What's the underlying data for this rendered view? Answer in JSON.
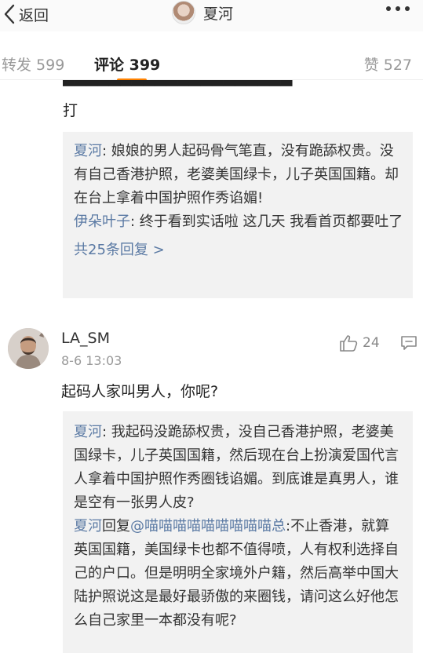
{
  "header": {
    "back_label": "返回",
    "title": "夏河"
  },
  "tabs": {
    "repost": "转发 599",
    "comments": "评论 399",
    "likes": "赞 527"
  },
  "prev_comment": {
    "text_tail": "打"
  },
  "prev_replies": {
    "items": [
      {
        "author": "夏河",
        "text": ": 娘娘的男人起码骨气笔直，没有跪舔权贵。没有自己香港护照，老婆美国绿卡，儿子英国国籍。却在台上拿着中国护照作秀谄媚!"
      },
      {
        "author": "伊朵叶子",
        "text": ": 终于看到实话啦 这几天 我看首页都要吐了"
      }
    ],
    "more": "共25条回复 >"
  },
  "comment": {
    "username": "LA_SM",
    "timestamp": "8-6 13:03",
    "like_count": "24",
    "text": "起码人家叫男人，你呢?"
  },
  "replies": {
    "r1_author": "夏河",
    "r1_text": ": 我起码没跪舔权贵，没自己香港护照，老婆美国绿卡，儿子英国国籍，然后现在台上扮演爱国代言人拿着中国护照作秀圈钱谄媚。到底谁是真男人，谁是空有一张男人皮?",
    "r2_author": "夏河",
    "r2_reply_word": "回复",
    "r2_mention": "@喵喵喵喵喵喵喵喵喵总",
    "r2_text": ":不止香港，就算英国国籍，美国绿卡也都不值得喷，人有权利选择自己的户口。但是明明全家境外户籍，然后高举中国大陆护照说这是最好最骄傲的来圈钱，请问这么好他怎么自己家里一本都没有呢?"
  }
}
